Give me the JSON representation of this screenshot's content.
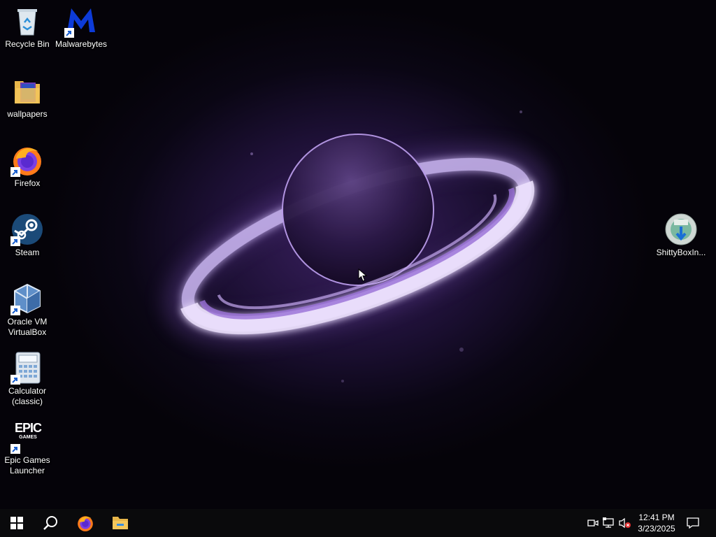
{
  "desktop": {
    "icons": [
      {
        "label": "Recycle Bin",
        "icon": "recycle-bin-icon"
      },
      {
        "label": "Malwarebytes",
        "icon": "malwarebytes-icon"
      },
      {
        "label": "wallpapers",
        "icon": "folder-icon"
      },
      {
        "label": "Firefox",
        "icon": "firefox-icon"
      },
      {
        "label": "Steam",
        "icon": "steam-icon"
      },
      {
        "label": "Oracle VM\nVirtualBox",
        "icon": "virtualbox-icon"
      },
      {
        "label": "Calculator\n(classic)",
        "icon": "calculator-icon"
      },
      {
        "label": "Epic Games\nLauncher",
        "icon": "epic-games-icon"
      },
      {
        "label": "ShittyBoxIn...",
        "icon": "installer-disc-icon"
      }
    ],
    "epic_logo_text": {
      "line1": "EPIC",
      "line2": "GAMES"
    }
  },
  "taskbar": {
    "buttons": [
      {
        "name": "start",
        "icon": "windows-logo-icon"
      },
      {
        "name": "search",
        "icon": "search-icon"
      },
      {
        "name": "firefox",
        "icon": "firefox-icon"
      },
      {
        "name": "file-explorer",
        "icon": "folder-icon"
      }
    ],
    "tray": {
      "icons": [
        "meet-now-icon",
        "network-icon",
        "volume-muted-icon",
        "notification-icon"
      ],
      "time": "12:41 PM",
      "date": "3/23/2025"
    }
  },
  "colors": {
    "taskbar": "#0a0a0c",
    "wallpaper_glow": "#c8a8ff",
    "text": "#ffffff"
  }
}
